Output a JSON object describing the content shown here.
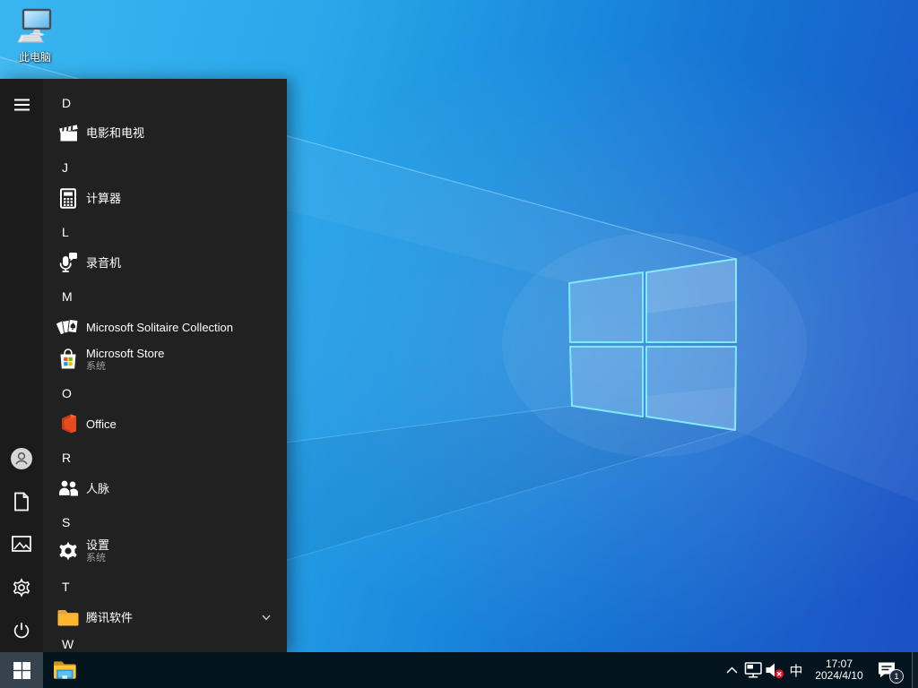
{
  "desktop": {
    "icons": [
      {
        "label": "此电脑",
        "icon": "this-pc-icon"
      }
    ]
  },
  "start_menu": {
    "sections": [
      {
        "letter": "D",
        "apps": [
          {
            "label": "电影和电视",
            "icon": "movies-tv-icon"
          }
        ]
      },
      {
        "letter": "J",
        "apps": [
          {
            "label": "计算器",
            "icon": "calculator-icon"
          }
        ]
      },
      {
        "letter": "L",
        "apps": [
          {
            "label": "录音机",
            "icon": "voice-recorder-icon"
          }
        ]
      },
      {
        "letter": "M",
        "apps": [
          {
            "label": "Microsoft Solitaire Collection",
            "icon": "solitaire-icon"
          },
          {
            "label": "Microsoft Store",
            "sublabel": "系统",
            "icon": "store-icon"
          }
        ]
      },
      {
        "letter": "O",
        "apps": [
          {
            "label": "Office",
            "icon": "office-icon"
          }
        ]
      },
      {
        "letter": "R",
        "apps": [
          {
            "label": "人脉",
            "icon": "people-icon"
          }
        ]
      },
      {
        "letter": "S",
        "apps": [
          {
            "label": "设置",
            "sublabel": "系统",
            "icon": "settings-icon"
          }
        ]
      },
      {
        "letter": "T",
        "apps": [
          {
            "label": "腾讯软件",
            "icon": "folder-icon",
            "expandable": true
          }
        ]
      },
      {
        "letter": "W",
        "apps": []
      }
    ],
    "rail_icons": [
      "hamburger-icon",
      "user-avatar",
      "documents-icon",
      "pictures-icon",
      "settings-gear-icon",
      "power-icon"
    ]
  },
  "taskbar": {
    "start_icon": "windows-logo-icon",
    "pinned": [
      "file-explorer-icon"
    ],
    "tray": {
      "hidden_icons_chevron": "chevron-up-icon",
      "network_icon": "network-icon",
      "volume_icon": "volume-muted-icon",
      "ime_label": "中",
      "time": "17:07",
      "date": "2024/4/10",
      "action_center_icon": "action-center-icon",
      "notification_count": "1"
    }
  },
  "colors": {
    "taskbar": "#03141f",
    "start_menu": "#212121",
    "start_button_active": "#36434e",
    "wallpaper_bright": "#2aa7ea",
    "wallpaper_deep": "#1a50c2",
    "logo_edge": "#7fe9ff",
    "store_red": "#f25022",
    "store_green": "#7fba00",
    "store_blue": "#00a4ef",
    "store_yellow": "#ffb900",
    "office_orange": "#e8491f",
    "folder_yellow": "#fdc630",
    "mute_red": "#e81123",
    "sublabel_gray": "#9e9e9e"
  }
}
